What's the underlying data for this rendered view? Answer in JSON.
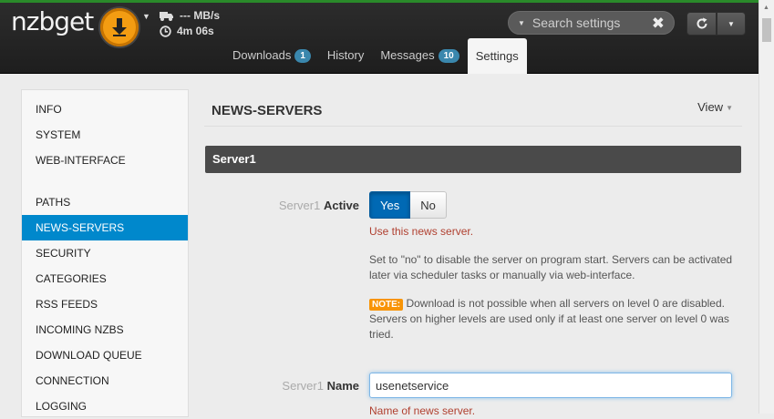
{
  "app": {
    "logo": "nzbget",
    "speed": "--- MB/s",
    "remaining_time": "4m 06s"
  },
  "tabs": [
    {
      "label": "Downloads",
      "badge": "1"
    },
    {
      "label": "History",
      "badge": ""
    },
    {
      "label": "Messages",
      "badge": "10"
    },
    {
      "label": "Settings",
      "badge": ""
    }
  ],
  "search": {
    "placeholder": "Search settings"
  },
  "sidebar": {
    "items": [
      {
        "label": "INFO"
      },
      {
        "label": "SYSTEM"
      },
      {
        "label": "WEB-INTERFACE"
      },
      {
        "label": "PATHS"
      },
      {
        "label": "NEWS-SERVERS"
      },
      {
        "label": "SECURITY"
      },
      {
        "label": "CATEGORIES"
      },
      {
        "label": "RSS FEEDS"
      },
      {
        "label": "INCOMING NZBS"
      },
      {
        "label": "DOWNLOAD QUEUE"
      },
      {
        "label": "CONNECTION"
      },
      {
        "label": "LOGGING"
      }
    ],
    "active": "NEWS-SERVERS"
  },
  "main": {
    "title": "NEWS-SERVERS",
    "view_label": "View",
    "section_title": "Server1",
    "active_option": {
      "prefix": "Server1",
      "label": "Active",
      "yes_label": "Yes",
      "no_label": "No",
      "selected": "Yes",
      "help_1": "Use this news server.",
      "help_2": "Set to \"no\" to disable the server on program start. Servers can be activated later via scheduler tasks or manually via web-interface.",
      "note_badge": "NOTE:",
      "help_3": " Download is not possible when all servers on level 0 are disabled. Servers on higher levels are used only if at least one server on level 0 was tried."
    },
    "name_option": {
      "prefix": "Server1",
      "label": "Name",
      "value": "usenetservice",
      "help": "Name of news server."
    }
  },
  "colors": {
    "accent": "#0088cc",
    "download_button": "#f39c12",
    "badge": "#3a87ad",
    "note": "#f89406"
  }
}
